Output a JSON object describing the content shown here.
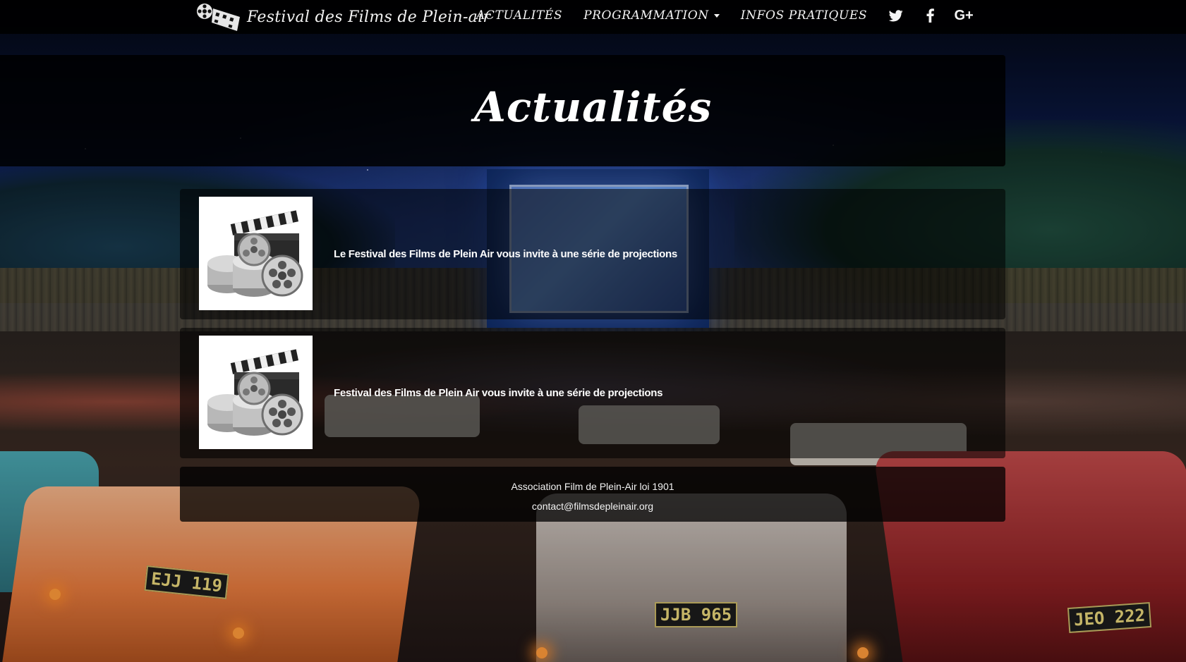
{
  "navbar": {
    "brand_text": "Festival des Films de Plein-air",
    "brand_logo_icon": "film-reel-clapper-logo",
    "items": [
      {
        "label": "ACTUALITÉS"
      },
      {
        "label": "PROGRAMMATION",
        "has_dropdown": true
      },
      {
        "label": "INFOS PRATIQUES"
      }
    ],
    "social": [
      {
        "icon": "twitter-icon"
      },
      {
        "icon": "facebook-icon"
      },
      {
        "icon": "google-plus-icon",
        "glyph": "G+"
      }
    ]
  },
  "page": {
    "title": "Actualités"
  },
  "news": [
    {
      "text": "Le Festival des Films de Plein Air vous invite à une série de projections",
      "thumbnail_icon": "film-clapper-reels-thumbnail"
    },
    {
      "text": "Festival des Films de Plein Air vous invite à une série de projections",
      "thumbnail_icon": "film-clapper-reels-thumbnail"
    }
  ],
  "footer": {
    "line1": "Association Film de Plein-Air loi 1901",
    "line2": "contact@filmsdepleinair.org"
  },
  "background": {
    "plates": [
      "EJJ 119",
      "JJB 965",
      "JEO 222"
    ]
  }
}
